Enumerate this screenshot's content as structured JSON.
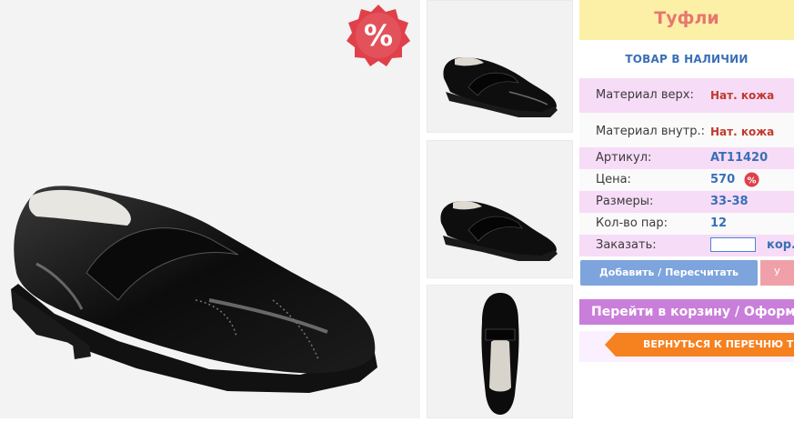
{
  "product": {
    "title": "Туфли",
    "stock_status": "ТОВАР В НАЛИЧИИ",
    "sale_badge": "%",
    "small_sale_badge": "%"
  },
  "details": {
    "material_top_label": "Материал верх:",
    "material_top_value": "Нат. кожа",
    "material_inner_label": "Материал внутр.:",
    "material_inner_value": "Нат. кожа",
    "article_label": "Артикул:",
    "article_value": "AT11420",
    "price_label": "Цена:",
    "price_value": "570",
    "sizes_label": "Размеры:",
    "sizes_value": "33-38",
    "pairs_label": "Кол-во пар:",
    "pairs_value": "12",
    "order_label": "Заказать:",
    "order_value": "",
    "order_unit": "кор."
  },
  "actions": {
    "add_label": "Добавить / Пересчитать",
    "side_label": "У",
    "cart_label": "Перейти в корзину / Оформить",
    "back_label": "ВЕРНУТЬСЯ К ПЕРЕЧНЮ ТОВАРОВ"
  },
  "colors": {
    "title_bg": "#fbf0a6",
    "title_text": "#e8766f",
    "row_pink": "#f7dcf7",
    "accent_blue": "#3a6fb6",
    "value_red": "#c0392b",
    "add_button": "#7da4dd",
    "cart_button": "#c97ed9",
    "back_button": "#f6811f"
  },
  "icons": {
    "sale": "percent-badge-icon",
    "back_arrow": "arrow-left-icon"
  }
}
